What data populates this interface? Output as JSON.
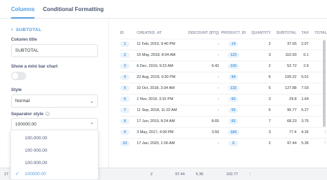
{
  "tabs": [
    "Columns",
    "Conditional Formatting"
  ],
  "sidebar": {
    "back_label": "SUBTOTAL",
    "column_title_label": "Column title",
    "column_title_value": "SUBTOTAL",
    "mini_bar_label": "Show a mini bar chart",
    "style_label": "Style",
    "style_value": "Normal",
    "separator_label": "Separator style",
    "separator_value": "100000.00"
  },
  "separator_options": [
    "100,000.00",
    "100 000,00",
    "100.000,00",
    "100000.00"
  ],
  "selected_option_index": 3,
  "table": {
    "columns": [
      "ID",
      "CREATED_AT",
      "DISCOUNT ($TQ)",
      "PRODUCT_ID",
      "QUANTITY",
      "SUBTOTAL",
      "TAX",
      "TOTAL"
    ],
    "rows": [
      [
        "1",
        "11 Feb, 2019, 9:40 PM",
        "-",
        "14",
        "2",
        "37.65",
        "2.07",
        "⋮"
      ],
      [
        "2",
        "15 May, 2018, 8:04 AM",
        "-",
        "123",
        "3",
        "110.93",
        "6.1",
        "⋮"
      ],
      [
        "3",
        "6 Dec, 2019, 9:22 AM",
        "6.42",
        "105",
        "2",
        "52.72",
        "2.9",
        "⋮"
      ],
      [
        "4",
        "22 Aug, 2019, 9:30 PM",
        "-",
        "94",
        "6",
        "109.22",
        "6.01",
        "⋮"
      ],
      [
        "5",
        "10 Oct, 2018, 3:34 AM",
        "-",
        "132",
        "5",
        "127.88",
        "7.03",
        "⋮"
      ],
      [
        "6",
        "1 Nov, 2019, 3:15 PM",
        "-",
        "60",
        "3",
        "29.8",
        "1.64",
        "⋮"
      ],
      [
        "7",
        "11 Sep, 2018, 11:22 AM",
        "-",
        "55",
        "5",
        "95.77",
        "5.27",
        "⋮"
      ],
      [
        "8",
        "17 Jun, 2019, 8:24 AM",
        "8.65",
        "65",
        "7",
        "68.23",
        "3.75",
        "⋮"
      ],
      [
        "9",
        "3 May, 2017, 4:00 PM",
        "3.59",
        "184",
        "3",
        "77.4",
        "4.26",
        "⋮"
      ],
      [
        "10",
        "17 Jan, 2020, 1:06 AM",
        "-",
        "6",
        "2",
        "97.44",
        "5.36",
        "⋮"
      ]
    ]
  },
  "background_footer": [
    "17",
    "2",
    "97.44",
    "5.36",
    "102.77",
    "⋮"
  ]
}
